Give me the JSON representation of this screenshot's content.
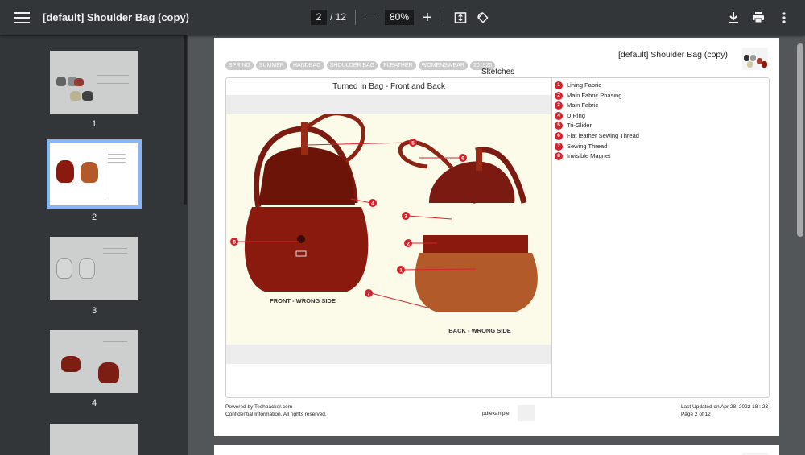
{
  "toolbar": {
    "title": "[default] Shoulder Bag (copy)",
    "current_page": "2",
    "total_pages": "/ 12",
    "zoom": "80%",
    "zoom_out_glyph": "—",
    "zoom_in_glyph": "+",
    "icons": [
      "menu-icon",
      "fit-page-icon",
      "rotate-icon",
      "download-icon",
      "print-icon",
      "more-vert-icon"
    ]
  },
  "sidebar": {
    "thumbnails": [
      {
        "label": "1"
      },
      {
        "label": "2"
      },
      {
        "label": "3"
      },
      {
        "label": "4"
      }
    ],
    "selected": "2"
  },
  "document": {
    "header_title": "[default] Shoulder Bag (copy)",
    "tags": [
      "SPRING",
      "SUMMER",
      "HANDBAG",
      "SHOULDER BAG",
      "PLEATHER",
      "WOMENSWEAR",
      "201920"
    ],
    "section_title": "Sketches",
    "panel_title": "Turned In Bag - Front and Back",
    "sketch_labels": {
      "front": "FRONT - WRONG SIDE",
      "back": "BACK - WRONG SIDE"
    },
    "legend": [
      {
        "num": "1",
        "label": "Lining Fabric"
      },
      {
        "num": "2",
        "label": "Main Fabric Phasing"
      },
      {
        "num": "3",
        "label": "Main Fabric"
      },
      {
        "num": "4",
        "label": "D Ring"
      },
      {
        "num": "5",
        "label": "Tri-Glider"
      },
      {
        "num": "6",
        "label": "Flat leather Sewing Thread"
      },
      {
        "num": "7",
        "label": "Sewing Thread"
      },
      {
        "num": "8",
        "label": "Invisible Magnet"
      }
    ],
    "footer": {
      "powered": "Powered by Techpacker.com",
      "confidential": "Confidential Information. All rights reserved.",
      "middle": "pdfexample",
      "updated": "Last Updated on Apr 28, 2022 18 : 23",
      "page_of": "Page 2 of 12"
    }
  },
  "colors": {
    "toolbar": "#323639",
    "viewer_bg": "#525659",
    "accent_selected": "#8ab4f8",
    "callout_red": "#d8222a",
    "leather": "#8b1a0e"
  }
}
